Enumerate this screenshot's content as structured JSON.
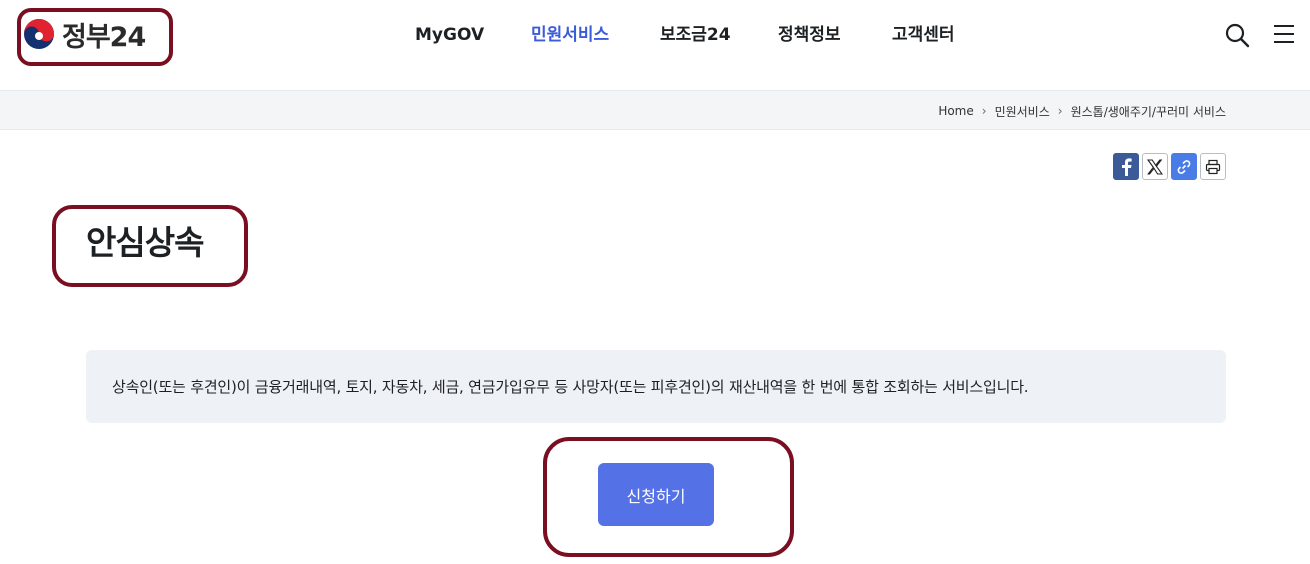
{
  "header": {
    "logo_text": "정부24",
    "nav": [
      {
        "label": "MyGOV",
        "active": false
      },
      {
        "label": "민원서비스",
        "active": true
      },
      {
        "label": "보조금24",
        "active": false
      },
      {
        "label": "정책정보",
        "active": false
      },
      {
        "label": "고객센터",
        "active": false
      }
    ],
    "search_icon": "search-icon",
    "menu_icon": "hamburger-menu-icon"
  },
  "breadcrumb": {
    "items": [
      "Home",
      "민원서비스",
      "원스톱/생애주기/꾸러미 서비스"
    ],
    "separator": "›"
  },
  "share": {
    "icons": [
      "facebook-icon",
      "x-twitter-icon",
      "link-copy-icon",
      "print-icon"
    ]
  },
  "main": {
    "title": "안심상속",
    "description": "상속인(또는 후견인)이 금융거래내역, 토지, 자동차, 세금, 연금가입유무 등 사망자(또는 피후견인)의 재산내역을 한 번에 통합 조회하는 서비스입니다.",
    "apply_label": "신청하기"
  },
  "colors": {
    "accent": "#3b5bdb",
    "button": "#5571e6",
    "annotation": "#7a0f22",
    "desc_bg": "#eef1f5"
  }
}
